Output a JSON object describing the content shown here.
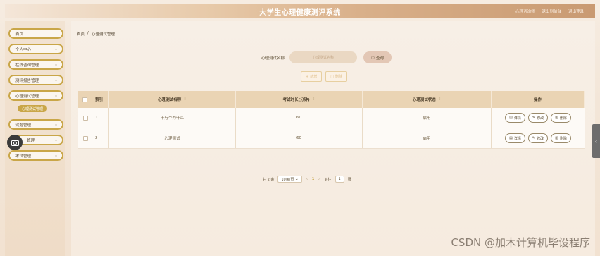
{
  "header": {
    "title": "大学生心理健康测评系统",
    "user_text": "心理咨询师",
    "back_label": "退出到前台",
    "logout_label": "退出登录"
  },
  "sidebar": {
    "items": [
      {
        "label": "首页",
        "has_chevron": false
      },
      {
        "label": "个人中心",
        "has_chevron": true
      },
      {
        "label": "在线咨询管理",
        "has_chevron": true
      },
      {
        "label": "测评报告管理",
        "has_chevron": true
      },
      {
        "label": "心理测试管理",
        "has_chevron": true
      },
      {
        "label": "试题管理",
        "has_chevron": true
      },
      {
        "label": "管理",
        "has_chevron": true
      },
      {
        "label": "考试管理",
        "has_chevron": true
      }
    ],
    "active_sub": "心理测试管理",
    "chevron_glyph": "⌄"
  },
  "breadcrumb": {
    "home": "首页",
    "sep": "/",
    "current": "心理测试管理"
  },
  "search": {
    "label": "心理测试名称",
    "placeholder": "心理测试名称",
    "button_label": "查询"
  },
  "actions": {
    "add_label": "新增",
    "delete_label": "删除"
  },
  "table": {
    "headers": {
      "index": "索引",
      "name": "心理测试名称",
      "time": "考试时长(分钟)",
      "status": "心理测试状态",
      "op": "操作"
    },
    "rows": [
      {
        "index": "1",
        "name": "十万个为什么",
        "time": "60",
        "status": "启用"
      },
      {
        "index": "2",
        "name": "心理测试",
        "time": "60",
        "status": "启用"
      }
    ],
    "op_labels": {
      "detail": "详情",
      "edit": "修改",
      "delete": "删除"
    }
  },
  "pagination": {
    "total": "共 2 条",
    "page_size": "10条/页",
    "prev": "<",
    "current_page": "1",
    "next": ">",
    "goto_prefix": "前往",
    "goto_value": "1",
    "goto_suffix": "页"
  },
  "watermark": "CSDN @加木计算机毕设程序",
  "colors": {
    "accent_gold": "#c9a648",
    "header_bg": "#d9b08a",
    "table_head": "#ead4b4"
  }
}
